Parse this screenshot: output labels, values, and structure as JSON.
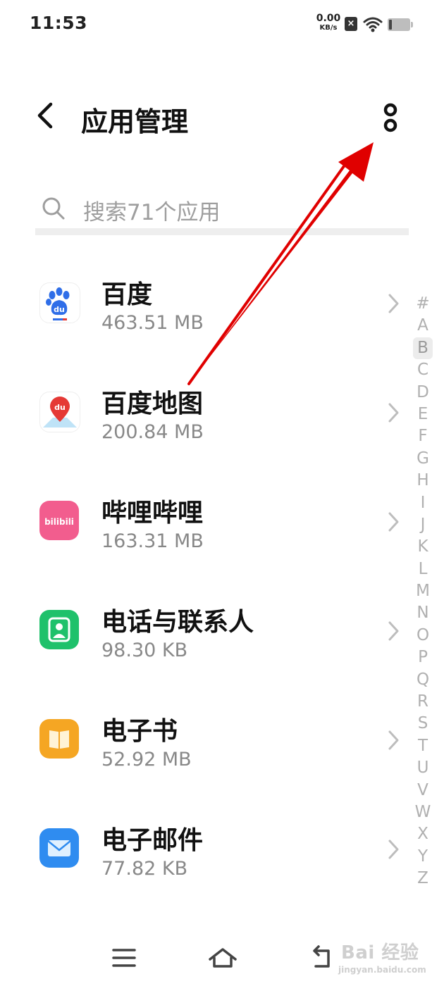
{
  "status_bar": {
    "time": "11:53",
    "net_speed_value": "0.00",
    "net_speed_unit": "KB/s",
    "icons": [
      "sim-off-icon",
      "wifi-icon",
      "battery-icon"
    ]
  },
  "header": {
    "title": "应用管理",
    "back_icon": "chevron-left-icon",
    "more_icon": "more-vertical-icon"
  },
  "search": {
    "placeholder": "搜索71个应用",
    "icon": "search-icon"
  },
  "apps": [
    {
      "name": "百度",
      "size": "463.51 MB",
      "icon": "baidu-app-icon",
      "color": "#2f6ee8"
    },
    {
      "name": "百度地图",
      "size": "200.84 MB",
      "icon": "baidu-maps-app-icon",
      "color": "#e53935"
    },
    {
      "name": "哔哩哔哩",
      "size": "163.31 MB",
      "icon": "bilibili-app-icon",
      "color": "#f25d8e"
    },
    {
      "name": "电话与联系人",
      "size": "98.30 KB",
      "icon": "contacts-app-icon",
      "color": "#1fc16b"
    },
    {
      "name": "电子书",
      "size": "52.92 MB",
      "icon": "ebook-app-icon",
      "color": "#f5a623"
    },
    {
      "name": "电子邮件",
      "size": "77.82 KB",
      "icon": "email-app-icon",
      "color": "#2f8cf0"
    }
  ],
  "app_icon_labels": {
    "baidu": "du",
    "baidu_maps": "du",
    "bilibili": "bilibili"
  },
  "alphabet_index": [
    "#",
    "A",
    "B",
    "C",
    "D",
    "E",
    "F",
    "G",
    "H",
    "I",
    "J",
    "K",
    "L",
    "M",
    "N",
    "O",
    "P",
    "Q",
    "R",
    "S",
    "T",
    "U",
    "V",
    "W",
    "X",
    "Y",
    "Z"
  ],
  "alphabet_active": "B",
  "annotation": {
    "type": "red-arrow",
    "points_to": "more-button",
    "color": "#e00000"
  },
  "nav_bar": {
    "icons": [
      "menu-icon",
      "home-icon",
      "back-icon"
    ]
  },
  "watermark": {
    "brand": "Bai 经验",
    "site": "jingyan.baidu.com"
  }
}
